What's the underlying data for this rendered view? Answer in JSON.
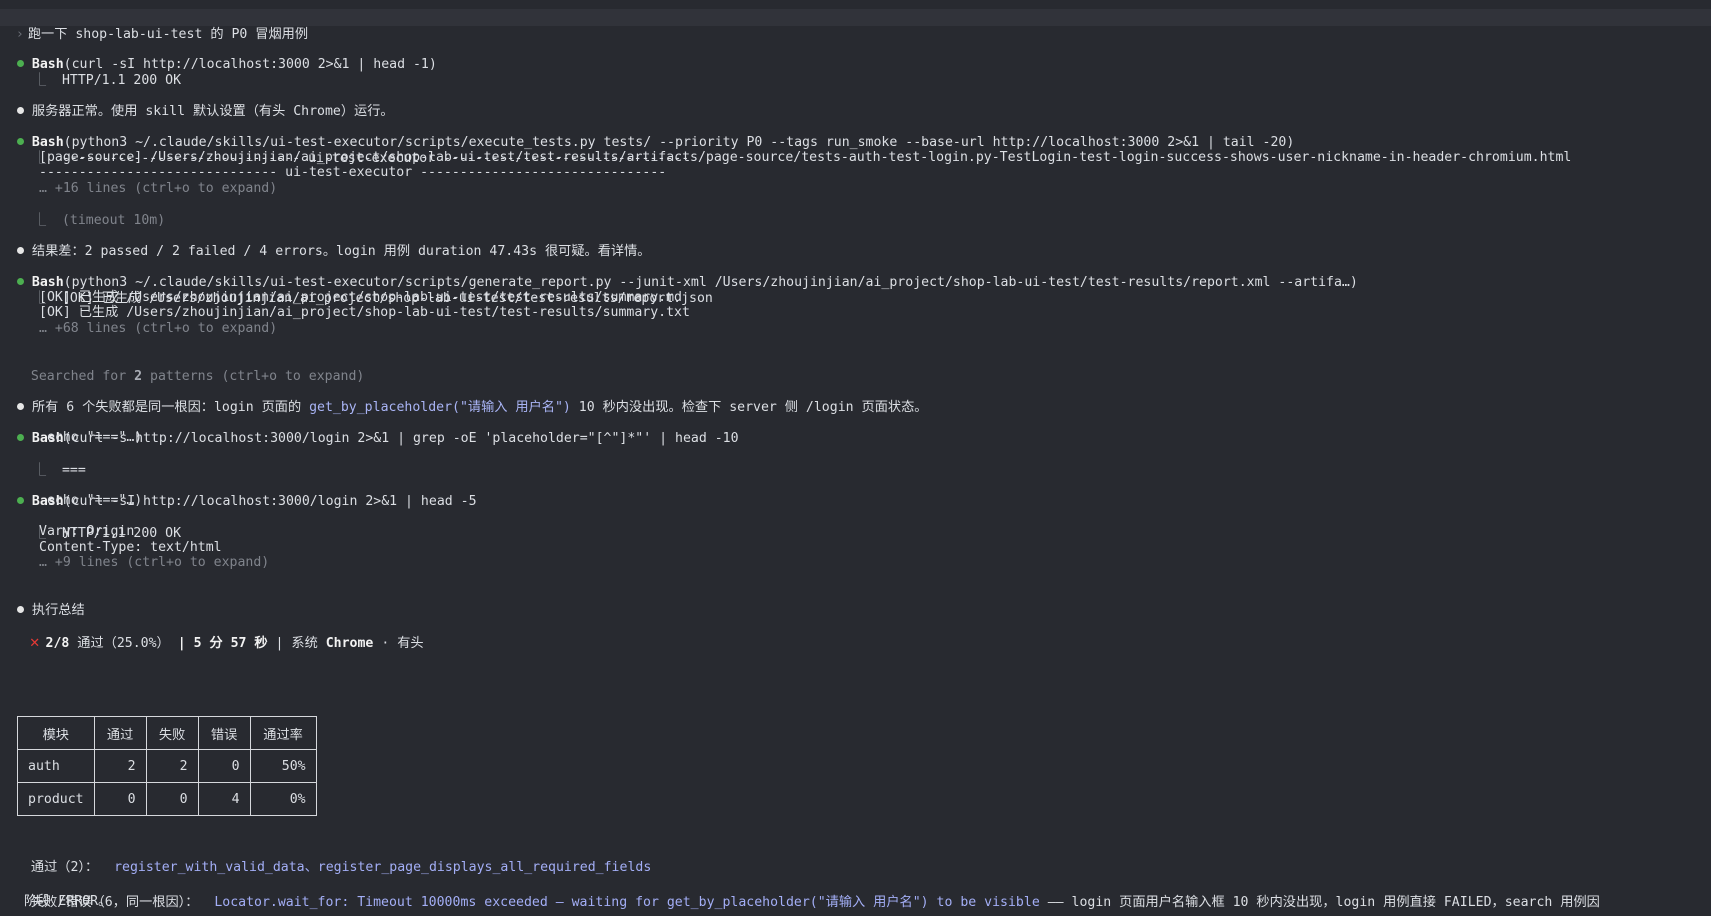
{
  "prompt": {
    "mark": "›",
    "text": "跑一下 shop-lab-ui-test 的 P0 冒烟用例"
  },
  "blocks": {
    "b1": {
      "tool": "Bash",
      "cmd": "(curl -sI http://localhost:3000 2>&1 | head -1)",
      "out": [
        "HTTP/1.1 200 OK"
      ]
    },
    "m1": "服务器正常。使用 skill 默认设置（有头 Chrome）运行。",
    "b2": {
      "tool": "Bash",
      "cmd": "(python3 ~/.claude/skills/ui-test-executor/scripts/execute_tests.py tests/ --priority P0 --tags run_smoke --base-url http://localhost:3000 2>&1 | tail -20)",
      "out": [
        "------------------------------ ui-test-executor -------------------------------",
        "[page-source] /Users/zhoujinjian/ai_project/shop-lab-ui-test/test-results/artifacts/page-source/tests-auth-test-login.py-TestLogin-test-login-success-shows-user-nickname-in-header-chromium.html",
        "------------------------------ ui-test-executor -------------------------------"
      ],
      "more": "… +16 lines (ctrl+o to expand)",
      "timeout": "(timeout 10m)"
    },
    "m2": "结果差：2 passed / 2 failed / 4 errors。login 用例 duration 47.43s 很可疑。看详情。",
    "b3": {
      "tool": "Bash",
      "cmd": "(python3 ~/.claude/skills/ui-test-executor/scripts/generate_report.py --junit-xml /Users/zhoujinjian/ai_project/shop-lab-ui-test/test-results/report.xml --artifa…)",
      "out": [
        "[OK] 已生成 /Users/zhoujinjian/ai_project/shop-lab-ui-test/test-results/report.json",
        "[OK] 已生成 /Users/zhoujinjian/ai_project/shop-lab-ui-test/test-results/summary.md",
        "[OK] 已生成 /Users/zhoujinjian/ai_project/shop-lab-ui-test/test-results/summary.txt"
      ],
      "more": "… +68 lines (ctrl+o to expand)"
    },
    "searched": {
      "prefix": "Searched for ",
      "count": "2",
      "suffix": " patterns (ctrl+o to expand)"
    },
    "m3": {
      "prefix": "所有 6 个失败都是同一根因：login 页面的 ",
      "code": "get_by_placeholder(\"请输入 用户名\")",
      "suffix": " 10 秒内没出现。检查下 server 侧 /login 页面状态。"
    },
    "b4": {
      "tool": "Bash",
      "cmd": "(curl -s http://localhost:3000/login 2>&1 | grep -oE 'placeholder=\"[^\"]*\"' | head -10",
      "cont": " echo \"===\"…)",
      "out": [
        "==="
      ]
    },
    "b5": {
      "tool": "Bash",
      "cmd": "(curl -sI http://localhost:3000/login 2>&1 | head -5",
      "cont": " echo \"===\"…)",
      "out": [
        "HTTP/1.1 200 OK",
        "Vary: Origin",
        "Content-Type: text/html"
      ],
      "more": "… +9 lines (ctrl+o to expand)"
    },
    "m4": "执行总结",
    "summary": {
      "pass_frac": "2/8",
      "pass_label": " 通过（25.0%）",
      "sep1": " | ",
      "duration": "5 分 57 秒",
      "sep2": " | 系统 ",
      "system": "Chrome",
      "mode": " · 有头"
    },
    "table": {
      "headers": [
        "模块",
        "通过",
        "失败",
        "错误",
        "通过率"
      ],
      "rows": [
        [
          "auth",
          "2",
          "2",
          "0",
          "50%"
        ],
        [
          "product",
          "0",
          "0",
          "4",
          "0%"
        ]
      ]
    },
    "passed": {
      "label": "通过（2）：",
      "items": "register_with_valid_data、register_page_displays_all_required_fields"
    },
    "failed": {
      "label": "失败/错误（6，同一根因）：",
      "code": "Locator.wait_for: Timeout 10000ms exceeded — waiting for get_by_placeholder(\"请输入 用户名\") to be visible",
      "desc": " —— login 页面用户名输入框 10 秒内没出现，login 用例直接 FAILED，search 用例因",
      "desc2": "阶段 ERROR。"
    }
  },
  "tree_char": "⎿",
  "colors": {
    "bg": "#282a30",
    "green": "#4caf50",
    "accent": "#a3aef6",
    "error": "#e53935"
  }
}
